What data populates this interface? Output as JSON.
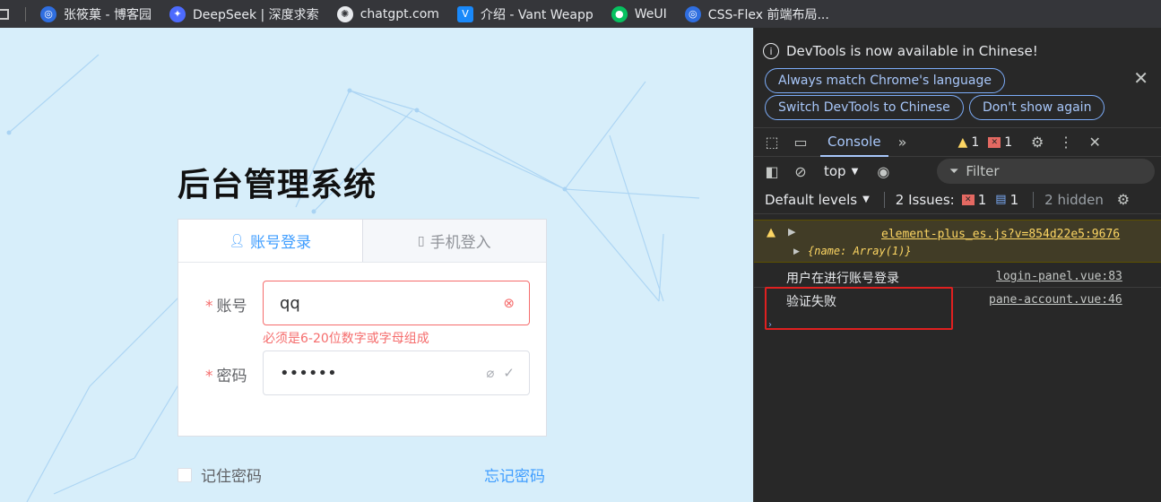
{
  "bookmarks": [
    {
      "label": "张筱菓 - 博客园",
      "icon": "cnblogs-icon",
      "color": "#2f6ee0"
    },
    {
      "label": "DeepSeek | 深度求索",
      "icon": "deepseek-icon",
      "color": "#4d6bfe"
    },
    {
      "label": "chatgpt.com",
      "icon": "chatgpt-icon",
      "color": "#e8eaed"
    },
    {
      "label": "介绍 - Vant Weapp",
      "icon": "vant-icon",
      "color": "#1989fa"
    },
    {
      "label": "WeUI",
      "icon": "wechat-icon",
      "color": "#07c160"
    },
    {
      "label": "CSS-Flex 前端布局...",
      "icon": "cnblogs-icon",
      "color": "#2f6ee0"
    }
  ],
  "login": {
    "title": "后台管理系统",
    "tab_account": "账号登录",
    "tab_phone": "手机登入",
    "account_label": "账号",
    "account_value": "qq",
    "account_error": "必须是6-20位数字或字母组成",
    "password_label": "密码",
    "password_value": "••••••",
    "remember_label": "记住密码",
    "forgot_label": "忘记密码"
  },
  "devtools": {
    "info_message": "DevTools is now available in Chinese!",
    "btn_match": "Always match Chrome's language",
    "btn_switch": "Switch DevTools to Chinese",
    "btn_dont_show": "Don't show again",
    "tab_console": "Console",
    "warn_count": "1",
    "error_count": "1",
    "context": "top",
    "filter_placeholder": "Filter",
    "default_levels": "Default levels",
    "issues_label": "2 Issues:",
    "issues_error_count": "1",
    "issues_info_count": "1",
    "hidden_label": "2 hidden",
    "messages": {
      "warn_source": "element-plus_es.js?v=854d22e5:9676",
      "warn_object": "{name: Array(1)}",
      "log1_text": "用户在进行账号登录",
      "log1_source": "login-panel.vue:83",
      "log2_text": "验证失败",
      "log2_source": "pane-account.vue:46"
    }
  }
}
